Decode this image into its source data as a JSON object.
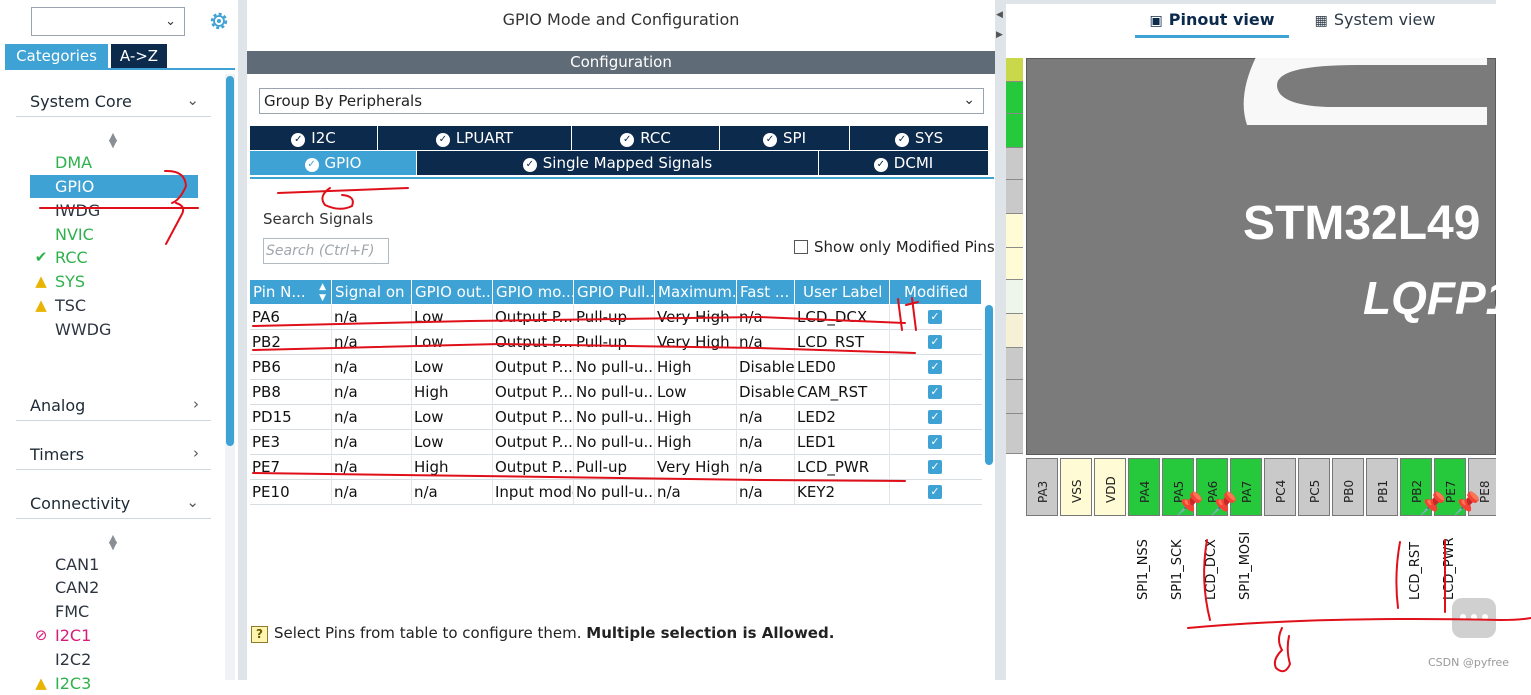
{
  "left": {
    "search_value": "",
    "tabs": {
      "categories": "Categories",
      "az": "A->Z"
    },
    "sections": {
      "system_core": "System Core",
      "analog": "Analog",
      "timers": "Timers",
      "connectivity": "Connectivity"
    },
    "system_core_items": [
      {
        "label": "DMA",
        "status": "none",
        "color": "green"
      },
      {
        "label": "GPIO",
        "status": "selected",
        "color": "white"
      },
      {
        "label": "IWDG",
        "status": "none",
        "color": "dark"
      },
      {
        "label": "NVIC",
        "status": "none",
        "color": "green"
      },
      {
        "label": "RCC",
        "status": "ok",
        "color": "green"
      },
      {
        "label": "SYS",
        "status": "warning",
        "color": "green"
      },
      {
        "label": "TSC",
        "status": "warning",
        "color": "dark"
      },
      {
        "label": "WWDG",
        "status": "none",
        "color": "dark"
      }
    ],
    "connectivity_items": [
      {
        "label": "CAN1",
        "status": "none",
        "color": "dark"
      },
      {
        "label": "CAN2",
        "status": "none",
        "color": "dark"
      },
      {
        "label": "FMC",
        "status": "none",
        "color": "dark"
      },
      {
        "label": "I2C1",
        "status": "disabled",
        "color": "magenta"
      },
      {
        "label": "I2C2",
        "status": "none",
        "color": "dark"
      },
      {
        "label": "I2C3",
        "status": "warning",
        "color": "green"
      }
    ]
  },
  "middle": {
    "title": "GPIO Mode and Configuration",
    "config_label": "Configuration",
    "group_by": "Group By Peripherals",
    "peripheral_tabs_row1": [
      "I2C",
      "LPUART",
      "RCC",
      "SPI",
      "SYS"
    ],
    "peripheral_tabs_row2": [
      "GPIO",
      "Single Mapped Signals",
      "DCMI"
    ],
    "active_tab": "GPIO",
    "search_label": "Search Signals",
    "search_placeholder": "Search (Ctrl+F)",
    "show_modified_label": "Show only Modified Pins",
    "table": {
      "headers": [
        "Pin N...",
        "Signal on ...",
        "GPIO out...",
        "GPIO mo...",
        "GPIO Pull...",
        "Maximum...",
        "Fast ...",
        "User Label",
        "Modified"
      ],
      "rows": [
        [
          "PA6",
          "n/a",
          "Low",
          "Output P...",
          "Pull-up",
          "Very High",
          "n/a",
          "LCD_DCX"
        ],
        [
          "PB2",
          "n/a",
          "Low",
          "Output P...",
          "Pull-up",
          "Very High",
          "n/a",
          "LCD_RST"
        ],
        [
          "PB6",
          "n/a",
          "Low",
          "Output P...",
          "No pull-u...",
          "High",
          "Disable",
          "LED0"
        ],
        [
          "PB8",
          "n/a",
          "High",
          "Output P...",
          "No pull-u...",
          "Low",
          "Disable",
          "CAM_RST"
        ],
        [
          "PD15",
          "n/a",
          "Low",
          "Output P...",
          "No pull-u...",
          "High",
          "n/a",
          "LED2"
        ],
        [
          "PE3",
          "n/a",
          "Low",
          "Output P...",
          "No pull-u...",
          "High",
          "n/a",
          "LED1"
        ],
        [
          "PE7",
          "n/a",
          "High",
          "Output P...",
          "Pull-up",
          "Very High",
          "n/a",
          "LCD_PWR"
        ],
        [
          "PE10",
          "n/a",
          "n/a",
          "Input mode",
          "No pull-u...",
          "n/a",
          "n/a",
          "KEY2"
        ]
      ],
      "modified": [
        true,
        true,
        true,
        true,
        true,
        true,
        true,
        true
      ]
    },
    "hint_text": "Select Pins from table to configure them. ",
    "hint_bold": "Multiple selection is Allowed."
  },
  "right": {
    "tab_pinout": "Pinout view",
    "tab_system": "System view",
    "chip_name": "STM32L49",
    "chip_package": "LQFP1",
    "bottom_pins": [
      {
        "label": "PA3",
        "color": "gray"
      },
      {
        "label": "VSS",
        "color": "yellow"
      },
      {
        "label": "VDD",
        "color": "yellow"
      },
      {
        "label": "PA4",
        "color": "green"
      },
      {
        "label": "PA5",
        "color": "green"
      },
      {
        "label": "PA6",
        "color": "green"
      },
      {
        "label": "PA7",
        "color": "green"
      },
      {
        "label": "PC4",
        "color": "gray"
      },
      {
        "label": "PC5",
        "color": "gray"
      },
      {
        "label": "PB0",
        "color": "gray"
      },
      {
        "label": "PB1",
        "color": "gray"
      },
      {
        "label": "PB2",
        "color": "green"
      },
      {
        "label": "PE7",
        "color": "green"
      },
      {
        "label": "PE8",
        "color": "gray"
      }
    ],
    "signals": [
      {
        "label": "SPI1_NSS",
        "pin": 3
      },
      {
        "label": "SPI1_SCK",
        "pin": 4
      },
      {
        "label": "LCD_DCX",
        "pin": 5
      },
      {
        "label": "SPI1_MOSI",
        "pin": 6
      },
      {
        "label": "LCD_RST",
        "pin": 11
      },
      {
        "label": "LCD_PWR",
        "pin": 12
      }
    ],
    "watermark": "CSDN @pyfree"
  },
  "colors": {
    "accent": "#3ea2d5",
    "navy": "#0c2a4b",
    "pin_green": "#27c93c",
    "annotation_red": "#e0101a"
  }
}
